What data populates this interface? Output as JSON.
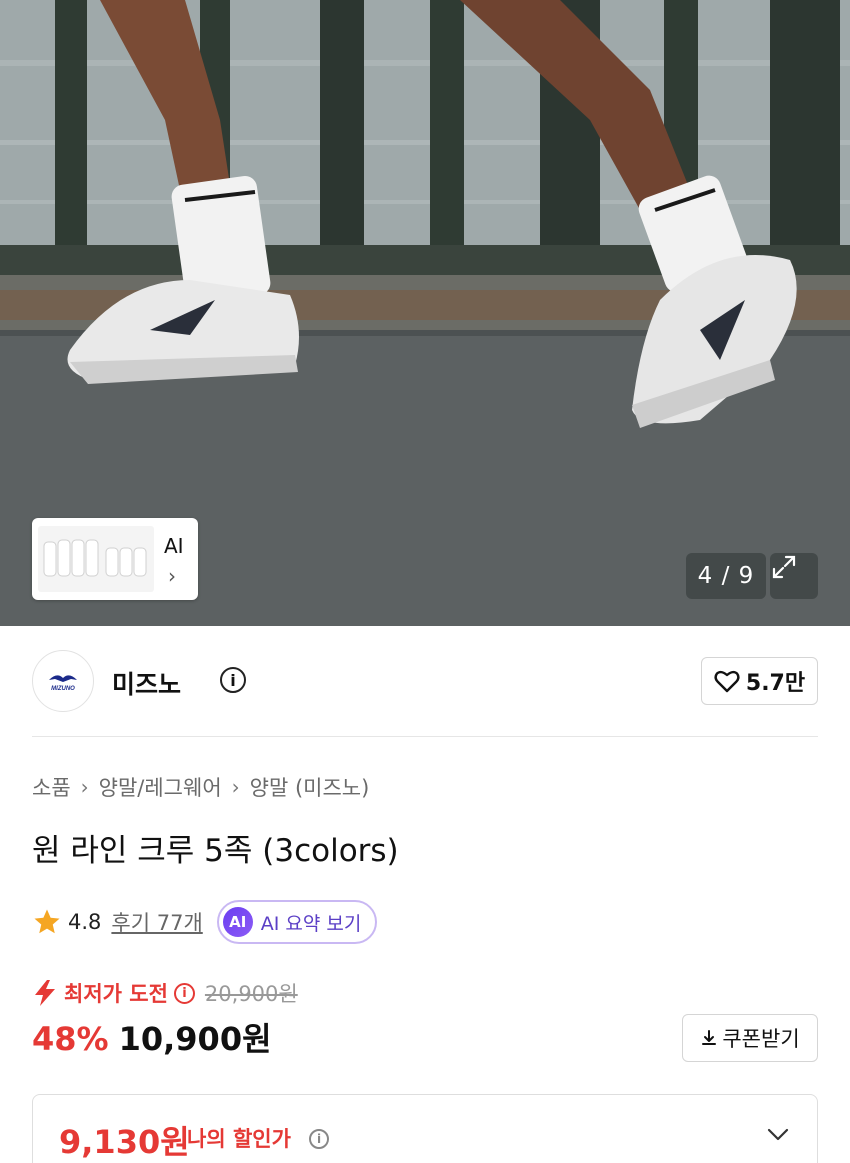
{
  "gallery": {
    "current": "4",
    "total": "9",
    "counter": "4 / 9",
    "ai_thumb_label": "AI",
    "ai_thumb_chevron": "›"
  },
  "brand": {
    "name": "미즈노",
    "logo_text": "MIZUNO",
    "info_icon": "ⓘ",
    "likes": "5.7만"
  },
  "breadcrumb": [
    "소품",
    "양말/레그웨어",
    "양말 (미즈노)"
  ],
  "breadcrumb_sep": "›",
  "product": {
    "title": "원 라인 크루 5족 (3colors)"
  },
  "rating": {
    "score": "4.8",
    "reviews": "후기 77개",
    "ai_badge": "AI",
    "ai_summary": "AI 요약 보기"
  },
  "price": {
    "lowest_label": "최저가 도전",
    "original": "20,900원",
    "discount": "48%",
    "sale": "10,900원",
    "coupon": "쿠폰받기",
    "my_price": "9,130원",
    "my_price_label": "나의 할인가"
  },
  "colors": {
    "accent_red": "#e53935",
    "ai_purple": "#6a3df0",
    "star": "#f5a623"
  },
  "icons": {
    "expand": "expand-icon",
    "heart": "heart-icon",
    "star": "star-icon",
    "bolt": "lightning-icon",
    "download": "download-icon",
    "chevron_down": "chevron-down-icon"
  }
}
